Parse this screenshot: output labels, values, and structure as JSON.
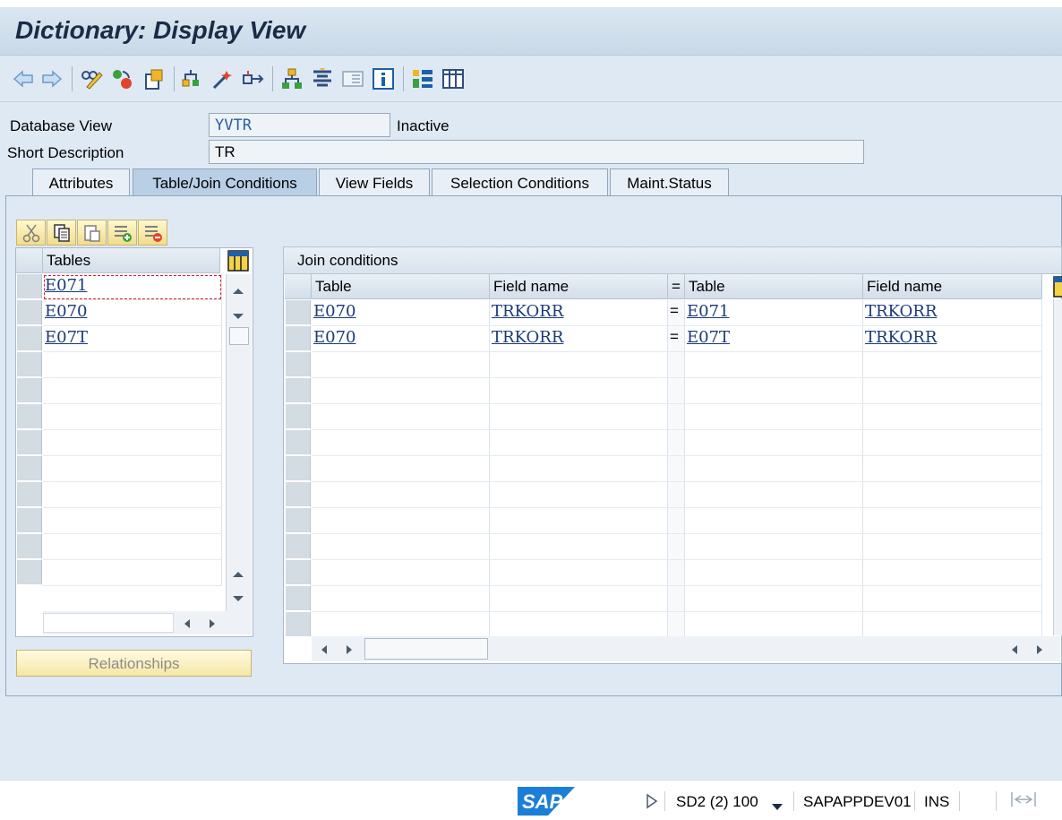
{
  "window": {
    "title": "Dictionary: Display View"
  },
  "toolbar": {
    "icons": [
      "back-icon",
      "forward-icon",
      "display-change-icon",
      "activate-icon",
      "other-object-icon",
      "where-used-icon",
      "check-icon",
      "navigation-icon",
      "hierarchy-icon",
      "align-icon",
      "documentation-icon",
      "info-icon",
      "layout-icon",
      "columns-icon"
    ]
  },
  "header": {
    "db_view_label": "Database View",
    "db_view_value": "YVTR",
    "status": "Inactive",
    "short_desc_label": "Short Description",
    "short_desc_value": "TR"
  },
  "tabs": [
    {
      "label": "Attributes"
    },
    {
      "label": "Table/Join Conditions",
      "active": true
    },
    {
      "label": "View Fields"
    },
    {
      "label": "Selection Conditions"
    },
    {
      "label": "Maint.Status"
    }
  ],
  "tables_grid": {
    "header": "Tables",
    "rows": [
      "E071",
      "E070",
      "E07T"
    ]
  },
  "join_grid": {
    "title": "Join conditions",
    "headers": {
      "table1": "Table",
      "field1": "Field name",
      "eq": "=",
      "table2": "Table",
      "field2": "Field name"
    },
    "rows": [
      {
        "table1": "E070",
        "field1": "TRKORR",
        "eq": "=",
        "table2": "E071",
        "field2": "TRKORR"
      },
      {
        "table1": "E070",
        "field1": "TRKORR",
        "eq": "=",
        "table2": "E07T",
        "field2": "TRKORR"
      }
    ]
  },
  "buttons": {
    "relationships": "Relationships"
  },
  "statusbar": {
    "logo": "SAP",
    "system": "SD2 (2) 100",
    "server": "SAPAPPDEV01",
    "mode": "INS"
  },
  "colors": {
    "accent": "#1b3a78",
    "title_bg": "#c9d9e8",
    "panel_bg": "#dfe9f4",
    "button_yellow": "#f6e7a6"
  }
}
